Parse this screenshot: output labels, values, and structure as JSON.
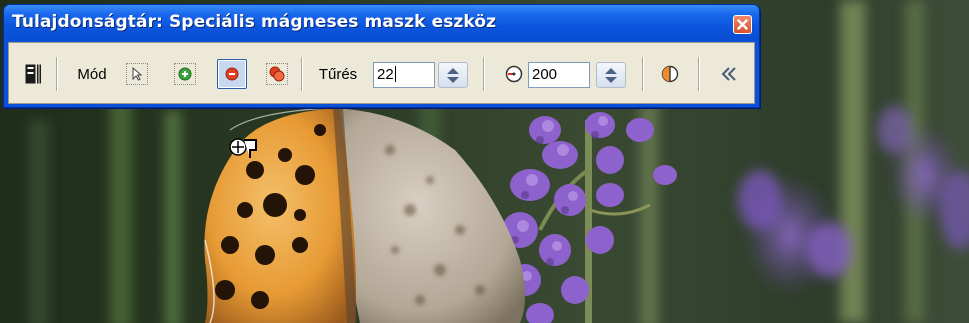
{
  "window": {
    "title": "Tulajdonságtár: Speciális mágneses maszk eszköz",
    "close_icon": "close-icon",
    "title_color": "#ffffff",
    "titlebar_color": "#0a55dd",
    "close_color": "#e0582e"
  },
  "toolbar": {
    "background": "#ece9d8",
    "items": {
      "panel_toggle_icon": "panel-toggle-icon",
      "mode_label": "Mód",
      "mode_buttons": [
        {
          "name": "select-mode",
          "icon": "arrow-cursor-icon",
          "active": false
        },
        {
          "name": "add-mode",
          "icon": "plus-circle-icon",
          "active": false
        },
        {
          "name": "subtract-mode",
          "icon": "minus-circle-icon",
          "active": true
        },
        {
          "name": "intersect-mode",
          "icon": "overlap-circles-icon",
          "active": false
        }
      ],
      "tolerance_label": "Tűrés",
      "tolerance_value": "22",
      "radius_icon": "radius-gauge-icon",
      "radius_value": "200",
      "invert_icon": "half-circle-icon",
      "collapse_icon": "double-chevron-left-icon"
    }
  },
  "background_image": {
    "description_icon": "butterfly-photo",
    "accent_lavender": "#8a62c8",
    "accent_wing": "#e9a03a"
  }
}
